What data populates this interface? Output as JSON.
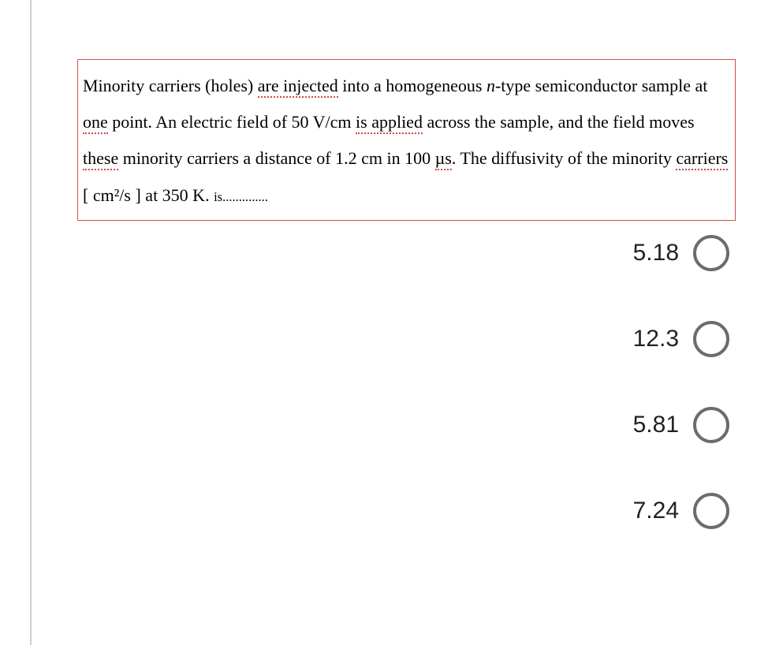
{
  "question": {
    "parts": [
      {
        "text": "Minority carriers (holes) "
      },
      {
        "text": "are injected",
        "underline": true
      },
      {
        "text": " into a homogeneous "
      },
      {
        "text": "n",
        "italic": true
      },
      {
        "text": "-type semiconductor sample at "
      },
      {
        "text": "one",
        "underline": true
      },
      {
        "text": " point. An electric field of 50 V/cm "
      },
      {
        "text": "is applied",
        "underline": true
      },
      {
        "text": " across the sample, and the field moves "
      },
      {
        "text": "these",
        "underline": true
      },
      {
        "text": " minority carriers a distance of 1.2 cm in 100 "
      },
      {
        "text": "µs",
        "underline": true
      },
      {
        "text": ". The diffusivity of the minority "
      },
      {
        "text": "carriers",
        "underline": true
      },
      {
        "text": "  [ cm²/s ] at 350 K. "
      },
      {
        "text": "is",
        "small": true
      },
      {
        "text": "..............",
        "small": true
      }
    ]
  },
  "options": [
    {
      "label": "5.18"
    },
    {
      "label": "12.3"
    },
    {
      "label": "5.81"
    },
    {
      "label": "7.24"
    }
  ]
}
